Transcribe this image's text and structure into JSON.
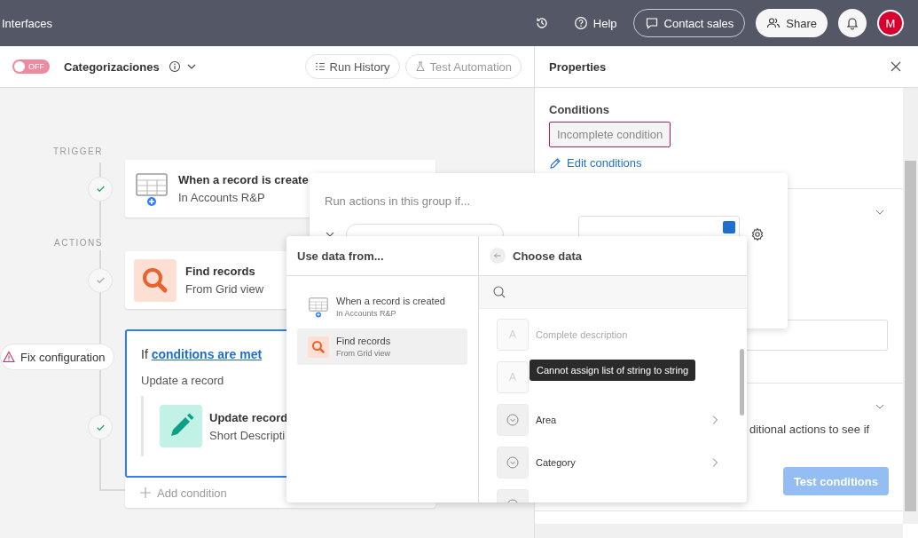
{
  "topbar": {
    "title": "Interfaces",
    "help": "Help",
    "contact_sales": "Contact sales",
    "share": "Share",
    "avatar": "M"
  },
  "toolbar": {
    "toggle": {
      "label": "OFF",
      "on": false
    },
    "name": "Categorizaciones",
    "run_history": "Run History",
    "test_automation": "Test Automation"
  },
  "canvas": {
    "trigger_label": "TRIGGER",
    "actions_label": "ACTIONS",
    "steps": [
      {
        "kind": "trigger",
        "title": "When a record is create",
        "subtitle": "In Accounts R&P",
        "done": true
      },
      {
        "kind": "find",
        "title": "Find records",
        "subtitle": "From Grid view",
        "done": false
      }
    ],
    "condition": {
      "prefix": "If",
      "link": "conditions are met",
      "action_label": "Update a record",
      "selected": true,
      "warning": "Fix configuration",
      "done": true,
      "inner_title": "Update record",
      "inner_subtitle": "Short Descripti",
      "add": "Add condition"
    }
  },
  "properties": {
    "title": "Properties",
    "conditions_label": "Conditions",
    "condition_status": "Incomplete condition",
    "edit": "Edit conditions",
    "partial_text": "ditional actions to see if",
    "test_button": "Test conditions",
    "test_disabled": true
  },
  "condition_popover": {
    "heading": "Run actions in this group if..."
  },
  "data_picker": {
    "left_title": "Use data from...",
    "sources": [
      {
        "kind": "trigger",
        "title": "When a record is created",
        "subtitle": "In Accounts R&P",
        "selected": false
      },
      {
        "kind": "find",
        "title": "Find records",
        "subtitle": "From Grid view",
        "selected": true
      }
    ],
    "right_title": "Choose data",
    "fields": [
      {
        "kind": "text",
        "label": "Complete description",
        "disabled": true
      },
      {
        "kind": "text",
        "disabled": true
      },
      {
        "kind": "select",
        "label": "Area",
        "disabled": false
      },
      {
        "kind": "select",
        "label": "Category",
        "disabled": false
      },
      {
        "kind": "select",
        "disabled": false
      }
    ]
  },
  "tooltip": "Cannot assign list of string to string"
}
